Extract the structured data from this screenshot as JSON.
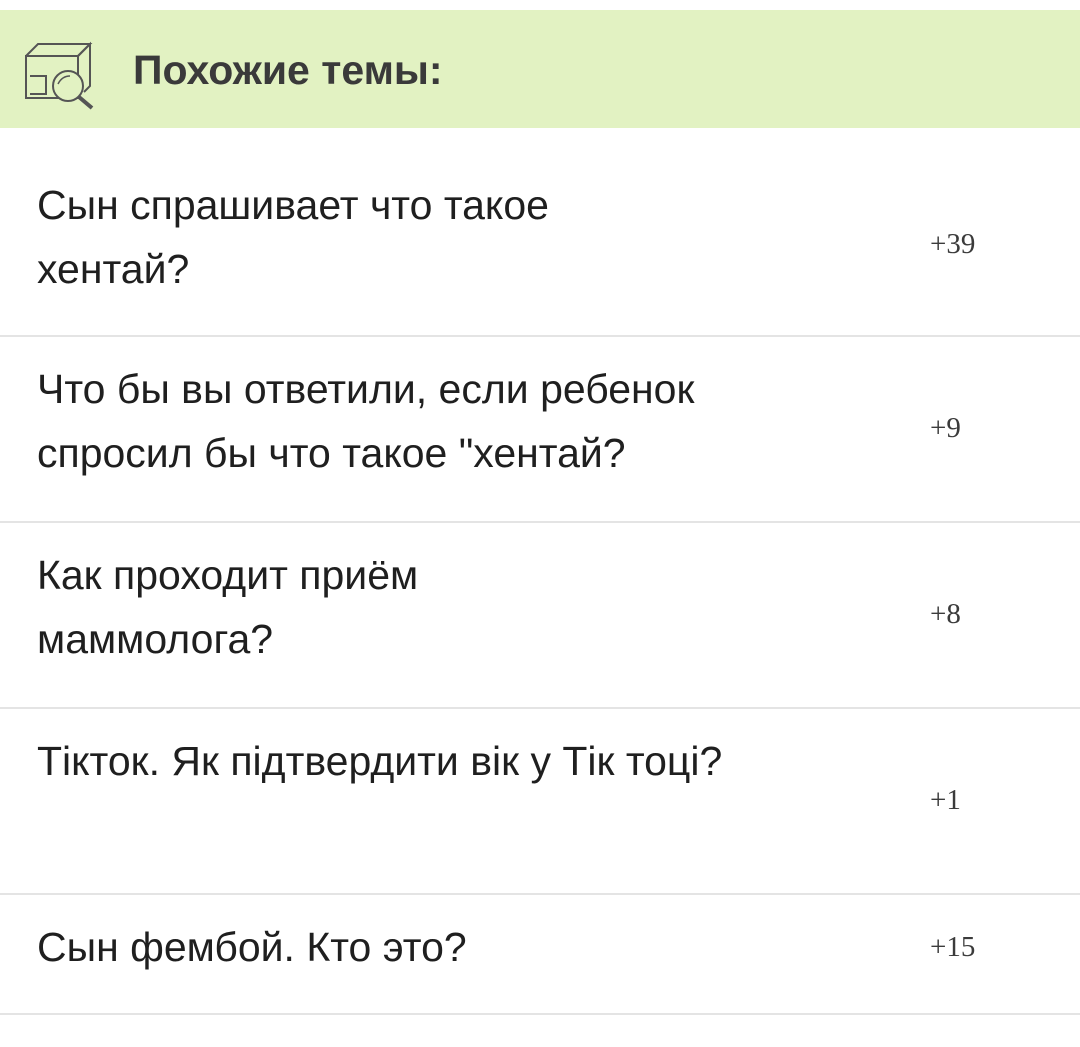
{
  "header": {
    "title": "Похожие темы:",
    "icon": "box-search-icon",
    "background": "#e2f2c2"
  },
  "topics": [
    {
      "title": "Сын спрашивает что такое хентай?",
      "votes": "+39"
    },
    {
      "title": "Что бы вы ответили, если ребенок спросил бы что такое \"хентай?",
      "votes": "+9"
    },
    {
      "title": "Как проходит приём маммолога?",
      "votes": "+8"
    },
    {
      "title": "Тікток. Як підтвердити вік у Тік тоці?",
      "votes": "+1"
    },
    {
      "title": "Сын фембой. Кто это?",
      "votes": "+15"
    }
  ]
}
